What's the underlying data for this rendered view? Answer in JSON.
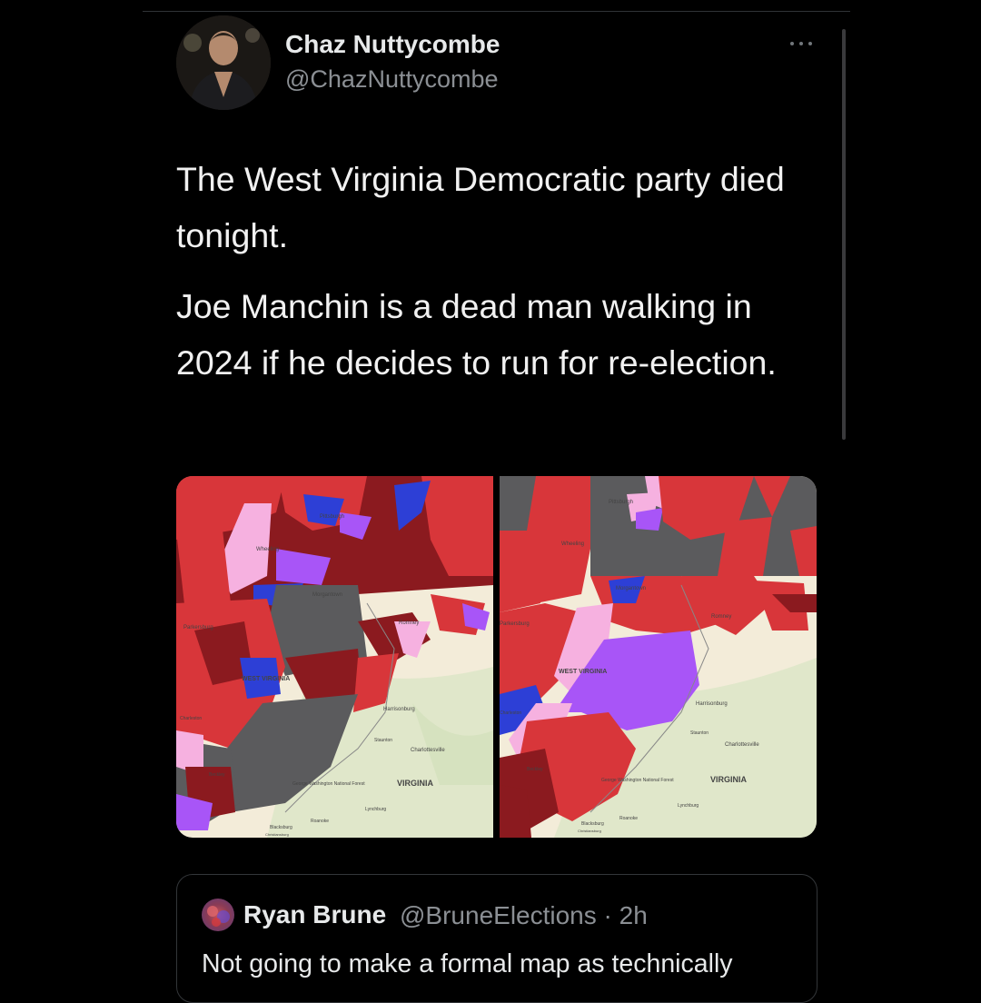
{
  "tweet": {
    "author_name": "Chaz Nuttycombe",
    "author_handle": "@ChazNuttycombe",
    "paragraphs": [
      "The West Virginia Democratic party died tonight.",
      "Joe Manchin is a dead man walking in 2024 if he decides to run for re-election."
    ],
    "more_icon": "more-horizontal-icon"
  },
  "media": {
    "left_map_labels": {
      "pittsburgh": "Pittsburgh",
      "wheeling": "Wheeling",
      "morgantown": "Morgantown",
      "parkersburg": "Parkersburg",
      "west_virginia": "WEST VIRGINIA",
      "romney": "Romney",
      "harrisonburg": "Harrisonburg",
      "staunton": "Staunton",
      "charlottesville": "Charlottesville",
      "virginia": "VIRGINIA",
      "gw_forest": "George Washington National Forest",
      "lynchburg": "Lynchburg",
      "roanoke": "Roanoke",
      "blacksburg": "Blacksburg",
      "christiansburg": "Christiansburg",
      "beckley": "Beckley",
      "charleston": "Charleston"
    },
    "right_map_labels": {
      "pittsburgh": "Pittsburgh",
      "wheeling": "Wheeling",
      "morgantown": "Morgantown",
      "parkersburg": "Parkersburg",
      "west_virginia": "WEST VIRGINIA",
      "romney": "Romney",
      "harrisonburg": "Harrisonburg",
      "staunton": "Staunton",
      "charlottesville": "Charlottesville",
      "virginia": "VIRGINIA",
      "gw_forest": "George Washington National Forest",
      "lynchburg": "Lynchburg",
      "roanoke": "Roanoke",
      "blacksburg": "Blacksburg",
      "christiansburg": "Christiansburg",
      "beckley": "Beckley",
      "charleston": "Charleston"
    },
    "colors": {
      "dark_red": "#8b1a1f",
      "red": "#d8363a",
      "light_pink": "#f6b1e0",
      "purple": "#a855f7",
      "blue": "#2d3fd6",
      "gray": "#5b5b5d",
      "base_map": "#f3ecd9",
      "forest": "#d7e6c3"
    }
  },
  "quote": {
    "author_name": "Ryan Brune",
    "meta": "@BruneElections · 2h",
    "text": "Not going to make a formal map as technically"
  }
}
